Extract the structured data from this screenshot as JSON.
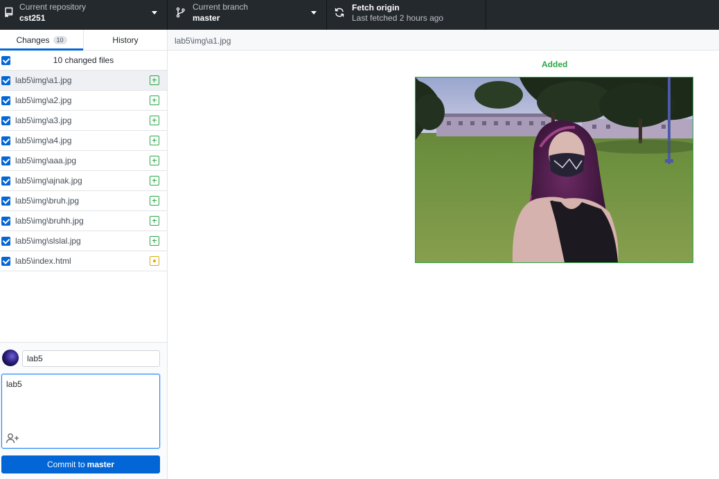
{
  "toolbar": {
    "repository": {
      "label": "Current repository",
      "value": "cst251",
      "icon": "repo-icon"
    },
    "branch": {
      "label": "Current branch",
      "value": "master",
      "icon": "branch-icon"
    },
    "fetch": {
      "title": "Fetch origin",
      "subtitle": "Last fetched 2 hours ago",
      "icon": "sync-icon"
    }
  },
  "sidebar": {
    "tabs": [
      {
        "label": "Changes",
        "count": "10",
        "active": true
      },
      {
        "label": "History",
        "active": false
      }
    ],
    "changes_header": "10 changed files",
    "files": [
      {
        "path": "lab5\\img\\a1.jpg",
        "status": "added",
        "checked": true,
        "selected": true
      },
      {
        "path": "lab5\\img\\a2.jpg",
        "status": "added",
        "checked": true
      },
      {
        "path": "lab5\\img\\a3.jpg",
        "status": "added",
        "checked": true
      },
      {
        "path": "lab5\\img\\a4.jpg",
        "status": "added",
        "checked": true
      },
      {
        "path": "lab5\\img\\aaa.jpg",
        "status": "added",
        "checked": true
      },
      {
        "path": "lab5\\img\\ajnak.jpg",
        "status": "added",
        "checked": true
      },
      {
        "path": "lab5\\img\\bruh.jpg",
        "status": "added",
        "checked": true
      },
      {
        "path": "lab5\\img\\bruhh.jpg",
        "status": "added",
        "checked": true
      },
      {
        "path": "lab5\\img\\slslal.jpg",
        "status": "added",
        "checked": true
      },
      {
        "path": "lab5\\index.html",
        "status": "modified",
        "checked": true
      }
    ]
  },
  "commit": {
    "summary": "lab5",
    "description": "lab5",
    "button_prefix": "Commit to",
    "button_branch": "master"
  },
  "main": {
    "path": "lab5\\img\\a1.jpg",
    "diff_label": "Added"
  },
  "colors": {
    "toolbar_bg": "#24292e",
    "accent": "#0366d6",
    "added": "#28a745",
    "modified": "#dbab09"
  }
}
